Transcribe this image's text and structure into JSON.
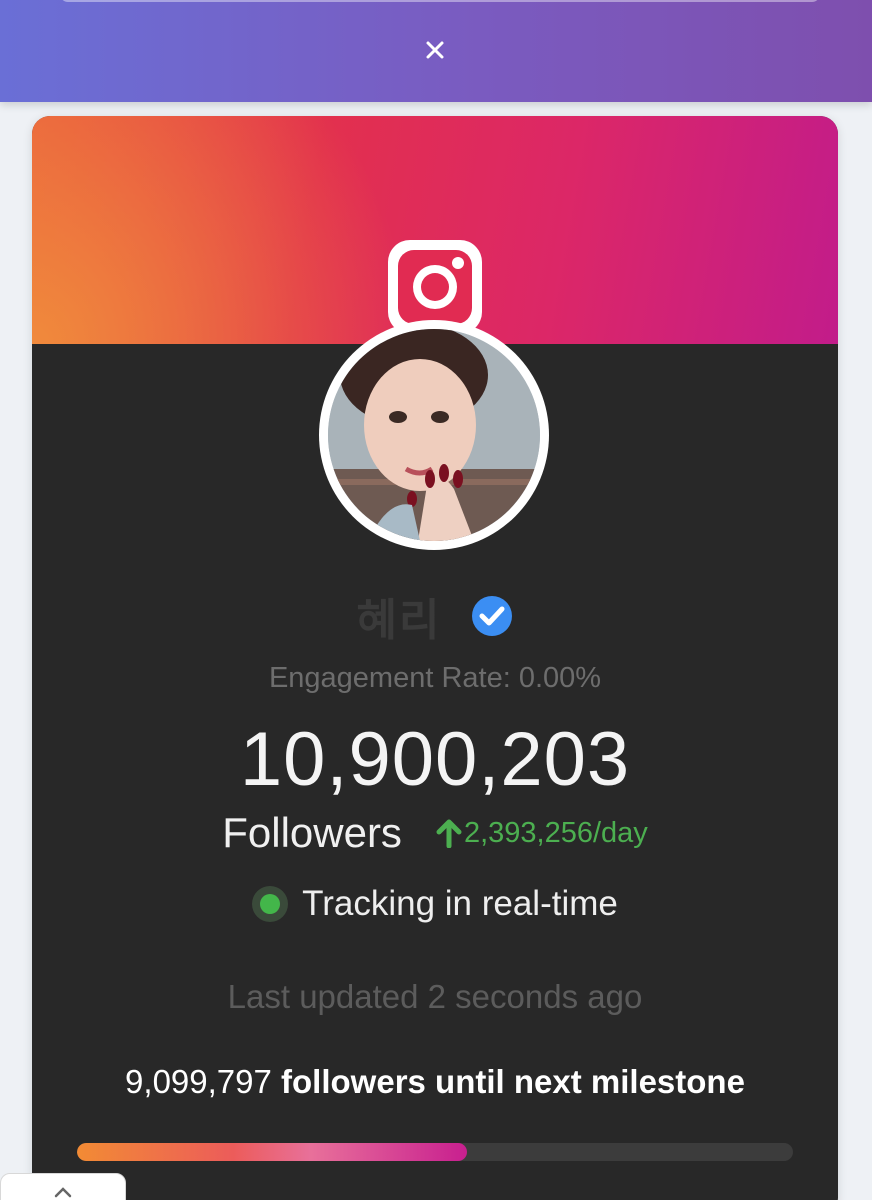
{
  "profile": {
    "name": "혜리",
    "verified": true,
    "engagement_rate": "Engagement Rate: 0.00%",
    "followers_count": "10,900,203",
    "followers_label": "Followers",
    "growth": "2,393,256/day",
    "tracking": "Tracking in real-time",
    "last_updated": "Last updated 2 seconds ago"
  },
  "milestone": {
    "remaining": "9,099,797",
    "text": "followers until next milestone",
    "progress_percent": 54.5
  },
  "icons": {
    "close": "close-icon",
    "instagram": "instagram-icon",
    "verified": "verified-badge-icon",
    "growth": "arrow-up-icon",
    "live": "live-dot-icon",
    "corner": "chevron-up-icon"
  },
  "colors": {
    "banner": "#7a5bc0",
    "card_bg": "#282828",
    "growth": "#4caf50",
    "live": "#43b64a",
    "verified": "#3b8ef3"
  }
}
